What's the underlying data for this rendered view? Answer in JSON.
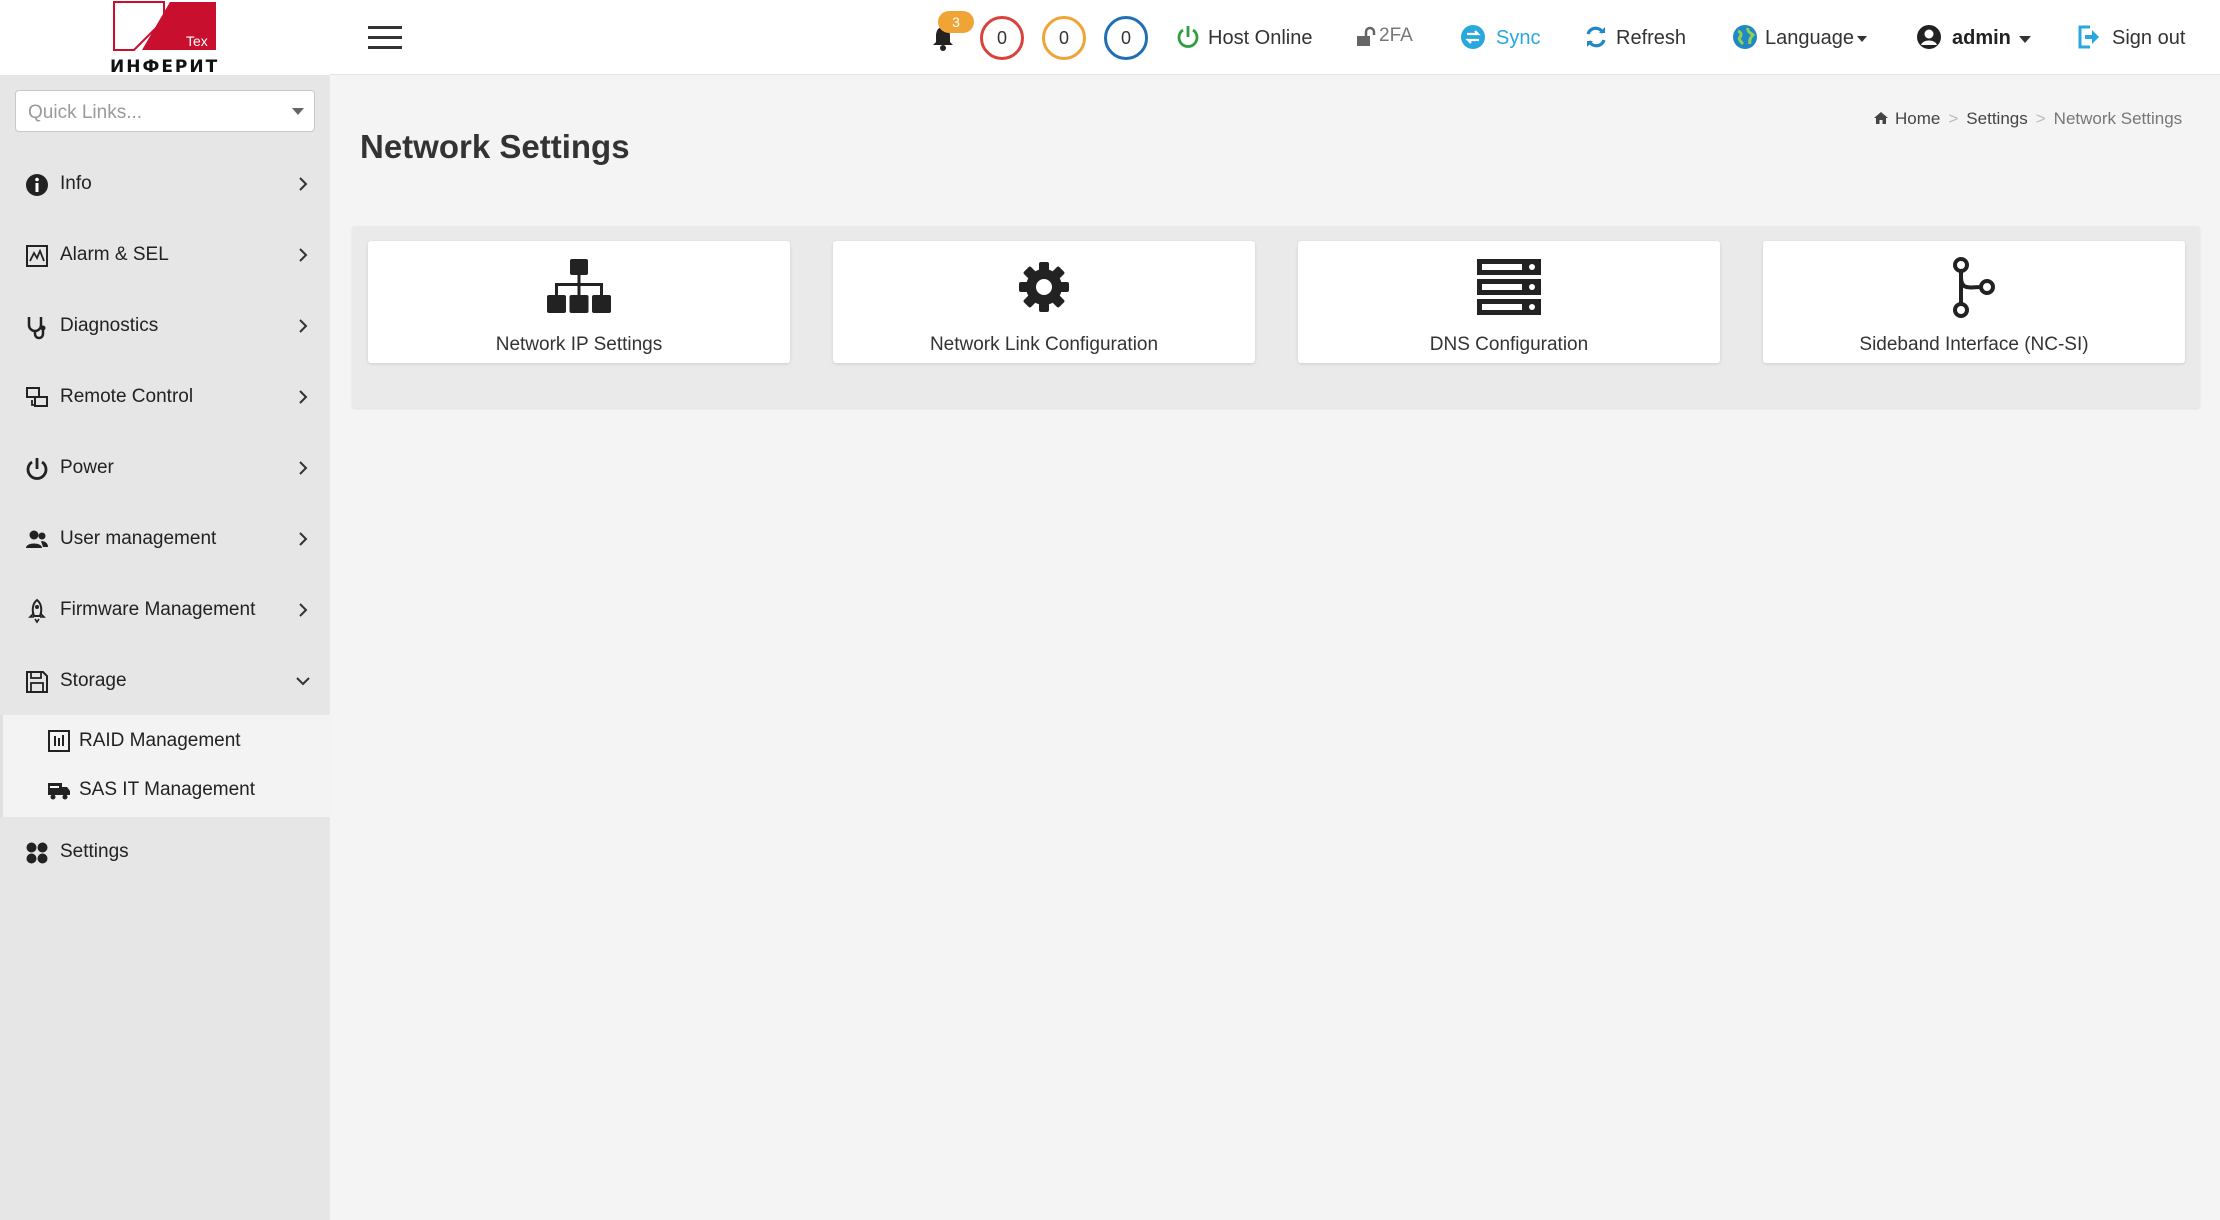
{
  "brand": {
    "logo_text": "ИНФЕРИТ",
    "logo_tag": "Tex"
  },
  "quick_links": {
    "placeholder": "Quick Links..."
  },
  "sidebar": {
    "items": [
      {
        "label": "Info",
        "icon": "info-icon"
      },
      {
        "label": "Alarm & SEL",
        "icon": "alarm-icon"
      },
      {
        "label": "Diagnostics",
        "icon": "stethoscope-icon"
      },
      {
        "label": "Remote Control",
        "icon": "remote-control-icon"
      },
      {
        "label": "Power",
        "icon": "power-icon"
      },
      {
        "label": "User management",
        "icon": "users-icon"
      },
      {
        "label": "Firmware Management",
        "icon": "rocket-icon"
      },
      {
        "label": "Storage",
        "icon": "floppy-icon",
        "expanded": true
      },
      {
        "label": "Settings",
        "icon": "grid-icon"
      }
    ],
    "storage_sub": [
      {
        "label": "RAID Management",
        "icon": "raid-icon"
      },
      {
        "label": "SAS IT Management",
        "icon": "sas-icon"
      }
    ]
  },
  "header": {
    "notifications_count": "3",
    "counters": [
      {
        "value": "0",
        "color": "#d9433b"
      },
      {
        "value": "0",
        "color": "#f0a436"
      },
      {
        "value": "0",
        "color": "#1f6fb5"
      }
    ],
    "host_status": "Host Online",
    "twofa": "2FA",
    "sync": "Sync",
    "refresh": "Refresh",
    "language": "Language",
    "user": "admin",
    "sign_out": "Sign out"
  },
  "page": {
    "title": "Network Settings",
    "breadcrumb": {
      "home": "Home",
      "settings": "Settings",
      "current": "Network Settings"
    }
  },
  "cards": [
    {
      "label": "Network IP Settings",
      "icon": "sitemap-icon"
    },
    {
      "label": "Network Link Configuration",
      "icon": "gear-icon"
    },
    {
      "label": "DNS Configuration",
      "icon": "server-icon"
    },
    {
      "label": "Sideband Interface (NC-SI)",
      "icon": "branch-icon"
    }
  ],
  "colors": {
    "brand_red": "#c8102e",
    "host_online": "#2e9e3f",
    "sync_blue": "#29a8e0",
    "refresh_blue": "#1e88c8"
  }
}
